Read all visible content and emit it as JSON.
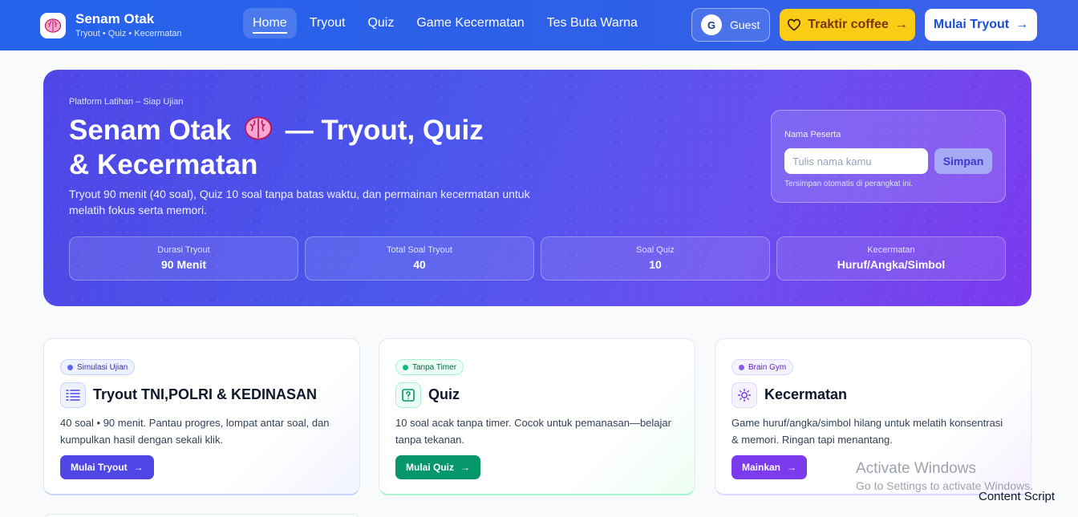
{
  "brand": {
    "title": "Senam Otak",
    "subtitle": "Tryout • Quiz • Kecermatan",
    "logo_icon": "brain-icon"
  },
  "nav": {
    "items": [
      {
        "label": "Home",
        "active": true
      },
      {
        "label": "Tryout",
        "active": false
      },
      {
        "label": "Quiz",
        "active": false
      },
      {
        "label": "Game Kecermatan",
        "active": false
      },
      {
        "label": "Tes Buta Warna",
        "active": false
      }
    ]
  },
  "user": {
    "avatar_initial": "G",
    "name": "Guest"
  },
  "topbar_buttons": {
    "coffee": "Traktir coffee",
    "start": "Mulai Tryout"
  },
  "hero": {
    "eyebrow": "Platform Latihan – Siap Ujian",
    "title_line1": "Senam Otak",
    "title_line1_rest": "— Tryout, Quiz",
    "title_line2": "& Kecermatan",
    "description": "Tryout 90 menit (40 soal), Quiz 10 soal tanpa batas waktu, dan permainan kecermatan untuk melatih fokus serta memori.",
    "name_card": {
      "label": "Nama Peserta",
      "placeholder": "Tulis nama kamu",
      "value": "",
      "save_label": "Simpan",
      "hint": "Tersimpan otomatis di perangkat ini."
    },
    "stats": [
      {
        "label": "Durasi Tryout",
        "value": "90 Menit"
      },
      {
        "label": "Total Soal Tryout",
        "value": "40"
      },
      {
        "label": "Soal Quiz",
        "value": "10"
      },
      {
        "label": "Kecermatan",
        "value": "Huruf/Angka/Simbol"
      }
    ]
  },
  "cards": [
    {
      "badge": "Simulasi Ujian",
      "title": "Tryout TNI,POLRI & KEDINASAN",
      "description": "40 soal • 90 menit. Pantau progres, lompat antar soal, dan kumpulkan hasil dengan sekali klik.",
      "button": "Mulai Tryout",
      "icon": "list-icon",
      "accent": "#4f46e5"
    },
    {
      "badge": "Tanpa Timer",
      "title": "Quiz",
      "description": "10 soal acak tanpa timer. Cocok untuk pemanasan—belajar tanpa tekanan.",
      "button": "Mulai Quiz",
      "icon": "quiz-icon",
      "accent": "#059669"
    },
    {
      "badge": "Brain Gym",
      "title": "Kecermatan",
      "description": "Game huruf/angka/simbol hilang untuk melatih konsentrasi & memori. Ringan tapi menantang.",
      "button": "Mainkan",
      "icon": "sun-icon",
      "accent": "#7c3aed"
    }
  ],
  "overlay": {
    "activate_title": "Activate Windows",
    "activate_sub": "Go to Settings to activate Windows.",
    "content_script": "Content Script"
  },
  "colors": {
    "topbar": "#2563eb",
    "coffee": "#facc15",
    "hero_start": "#4f46e5",
    "hero_end": "#7c3aed"
  }
}
